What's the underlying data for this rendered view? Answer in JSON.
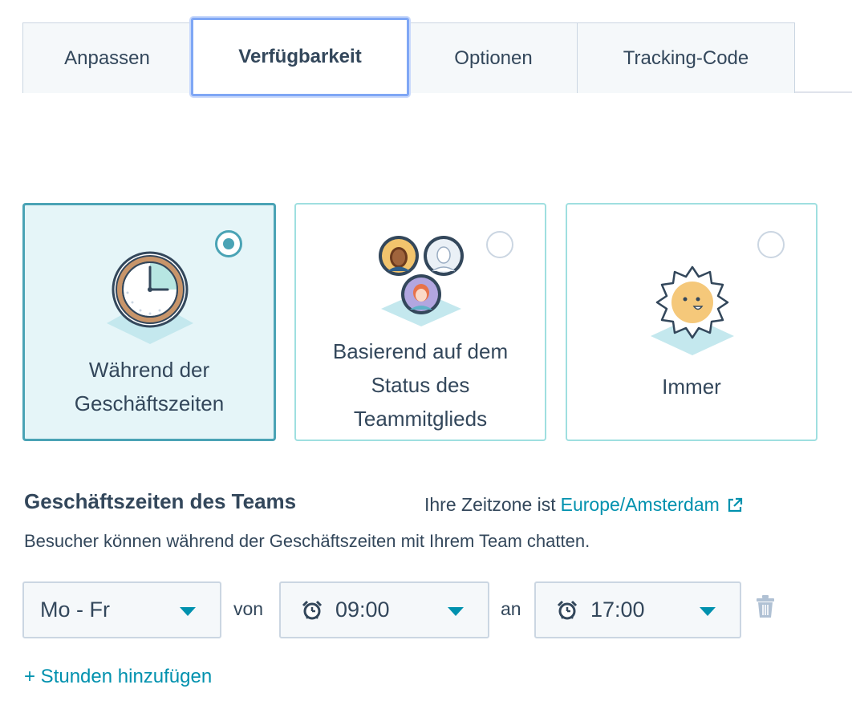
{
  "tabs": [
    {
      "label": "Anpassen"
    },
    {
      "label": "Verfügbarkeit"
    },
    {
      "label": "Optionen"
    },
    {
      "label": "Tracking-Code"
    }
  ],
  "availability_options": [
    {
      "label_line1": "Während der",
      "label_line2": "Geschäftszeiten",
      "selected": true,
      "icon": "clock-icon"
    },
    {
      "label_line1": "Basierend auf dem",
      "label_line2": "Status des",
      "label_line3": "Teammitglieds",
      "selected": false,
      "icon": "team-avatars-icon"
    },
    {
      "label_line1": "Immer",
      "selected": false,
      "icon": "sun-icon"
    }
  ],
  "section": {
    "title": "Geschäftszeiten des Teams",
    "timezone_prefix": "Ihre Zeitzone ist",
    "timezone_link": "Europe/Amsterdam",
    "description": "Besucher können während der Geschäftszeiten mit Ihrem Team chatten."
  },
  "hours_row": {
    "days": "Mo - Fr",
    "from_label": "von",
    "from_time": "09:00",
    "to_label": "an",
    "to_time": "17:00"
  },
  "add_hours": "+ Stunden hinzufügen",
  "colors": {
    "accent": "#0091ae",
    "selected_border": "#4aa3b5",
    "text": "#33475b"
  }
}
